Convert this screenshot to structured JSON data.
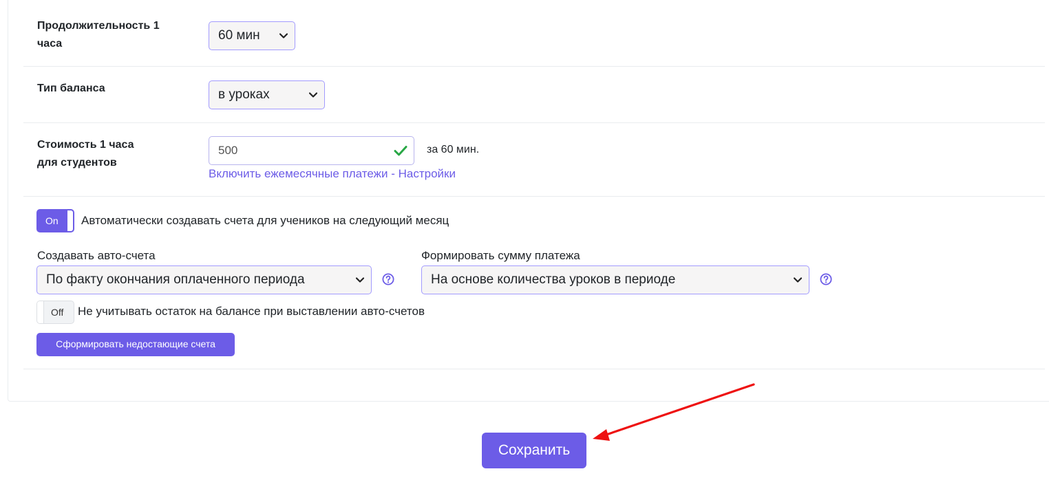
{
  "hour_duration": {
    "label_line1": "Продолжительность 1",
    "label_line2": "часа",
    "value": "60 мин"
  },
  "balance_type": {
    "label": "Тип баланса",
    "value": "в уроках"
  },
  "student_cost": {
    "label_line1": "Стоимость 1 часа",
    "label_line2": "для студентов",
    "value": "500",
    "suffix": "за 60 мин.",
    "monthly_link": "Включить ежемесячные платежи - Настройки"
  },
  "auto_invoices": {
    "toggle_label": "On",
    "description": "Автоматически создавать счета для учеников на следующий месяц",
    "create_label": "Создавать авто-счета",
    "create_value": "По факту окончания оплаченного периода",
    "amount_label": "Формировать сумму платежа",
    "amount_value": "На основе количества уроков в периоде"
  },
  "ignore_balance": {
    "toggle_label": "Off",
    "description": "Не учитывать остаток на балансе при выставлении авто-счетов"
  },
  "generate_button": "Сформировать недостающие счета",
  "save_button": "Сохранить",
  "colors": {
    "accent": "#6c5ce7",
    "success": "#28a745",
    "annotation": "#ee1111"
  },
  "icons": {
    "select": "chevron-down-icon",
    "valid": "check-icon",
    "help": "question-circle-icon",
    "annotation": "arrow-icon"
  }
}
